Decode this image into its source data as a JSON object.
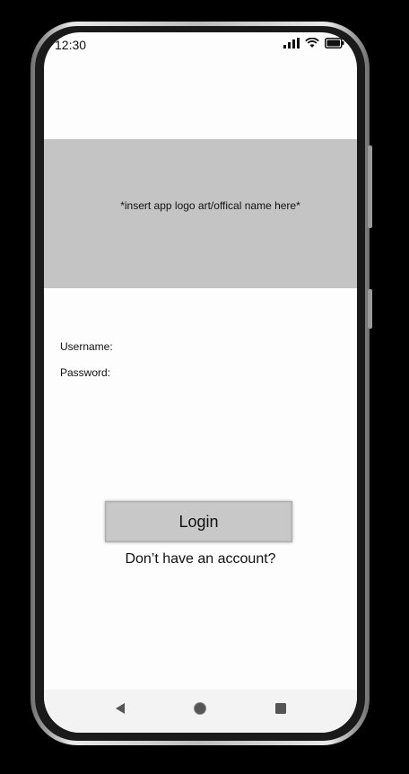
{
  "status_bar": {
    "time": "12:30",
    "icons": [
      "signal-icon",
      "wifi-icon",
      "battery-icon"
    ]
  },
  "logo_banner": {
    "text": "*insert app logo art/offical name here*"
  },
  "form": {
    "username_label": "Username:",
    "password_label": "Password:"
  },
  "actions": {
    "login_label": "Login",
    "signup_text": "Don’t have an account?"
  },
  "nav_bar": {
    "buttons": [
      "back-icon",
      "home-icon",
      "recents-icon"
    ]
  },
  "colors": {
    "banner": "#c4c4c4",
    "button": "#c8c8c8",
    "screen": "#fdfdfd"
  }
}
